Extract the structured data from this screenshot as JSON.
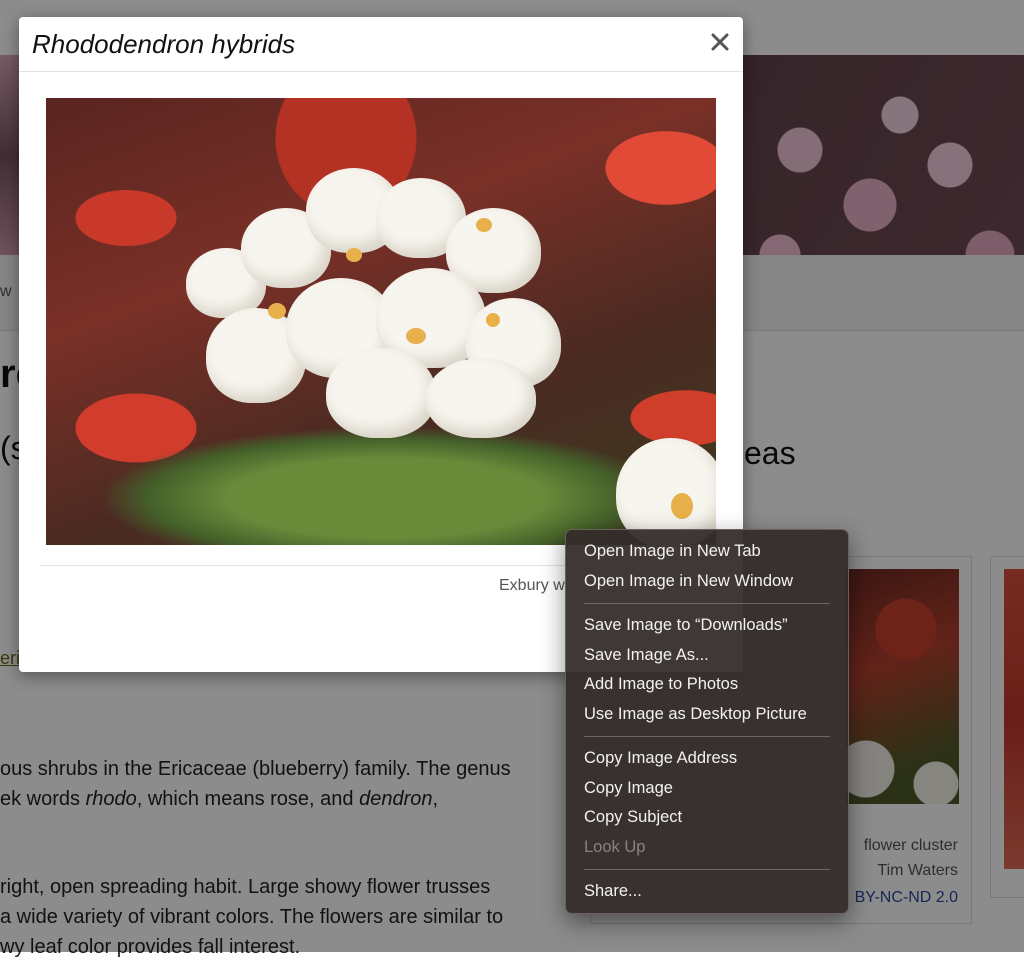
{
  "background": {
    "tab_fragment": "w",
    "heading_fragment": "re",
    "subheading_left": "(s",
    "subheading_right": "eas",
    "link_fragment": "eri",
    "paragraph1_line1": "ous shrubs in the Ericaceae (blueberry) family. The genus",
    "paragraph1_line2_a": "ek words ",
    "paragraph1_line2_b": "rhodo",
    "paragraph1_line2_c": ", which means rose, and ",
    "paragraph1_line2_d": "dendron",
    "paragraph1_line2_e": ",",
    "paragraph2_line1": "right, open spreading habit.  Large showy flower trusses",
    "paragraph2_line2": "a wide variety of vibrant colors.  The flowers are similar to",
    "paragraph2_line3": "wy leaf color provides fall interest.",
    "card": {
      "caption1": "flower cluster",
      "caption2": "Tim Waters",
      "license": "BY-NC-ND 2.0"
    }
  },
  "modal": {
    "title": "Rhododendron hybrids",
    "close_label": "×",
    "caption": "Exbury w"
  },
  "context_menu": {
    "items": [
      {
        "label": "Open Image in New Tab",
        "enabled": true
      },
      {
        "label": "Open Image in New Window",
        "enabled": true
      },
      {
        "label": "Save Image to “Downloads”",
        "enabled": true
      },
      {
        "label": "Save Image As...",
        "enabled": true
      },
      {
        "label": "Add Image to Photos",
        "enabled": true
      },
      {
        "label": "Use Image as Desktop Picture",
        "enabled": true
      },
      {
        "label": "Copy Image Address",
        "enabled": true
      },
      {
        "label": "Copy Image",
        "enabled": true
      },
      {
        "label": "Copy Subject",
        "enabled": true
      },
      {
        "label": "Look Up",
        "enabled": false
      },
      {
        "label": "Share...",
        "enabled": true
      }
    ]
  },
  "colors": {
    "overlay": "#000000",
    "menu_background": "#342c2a",
    "link_color": "#2c4a9c"
  }
}
